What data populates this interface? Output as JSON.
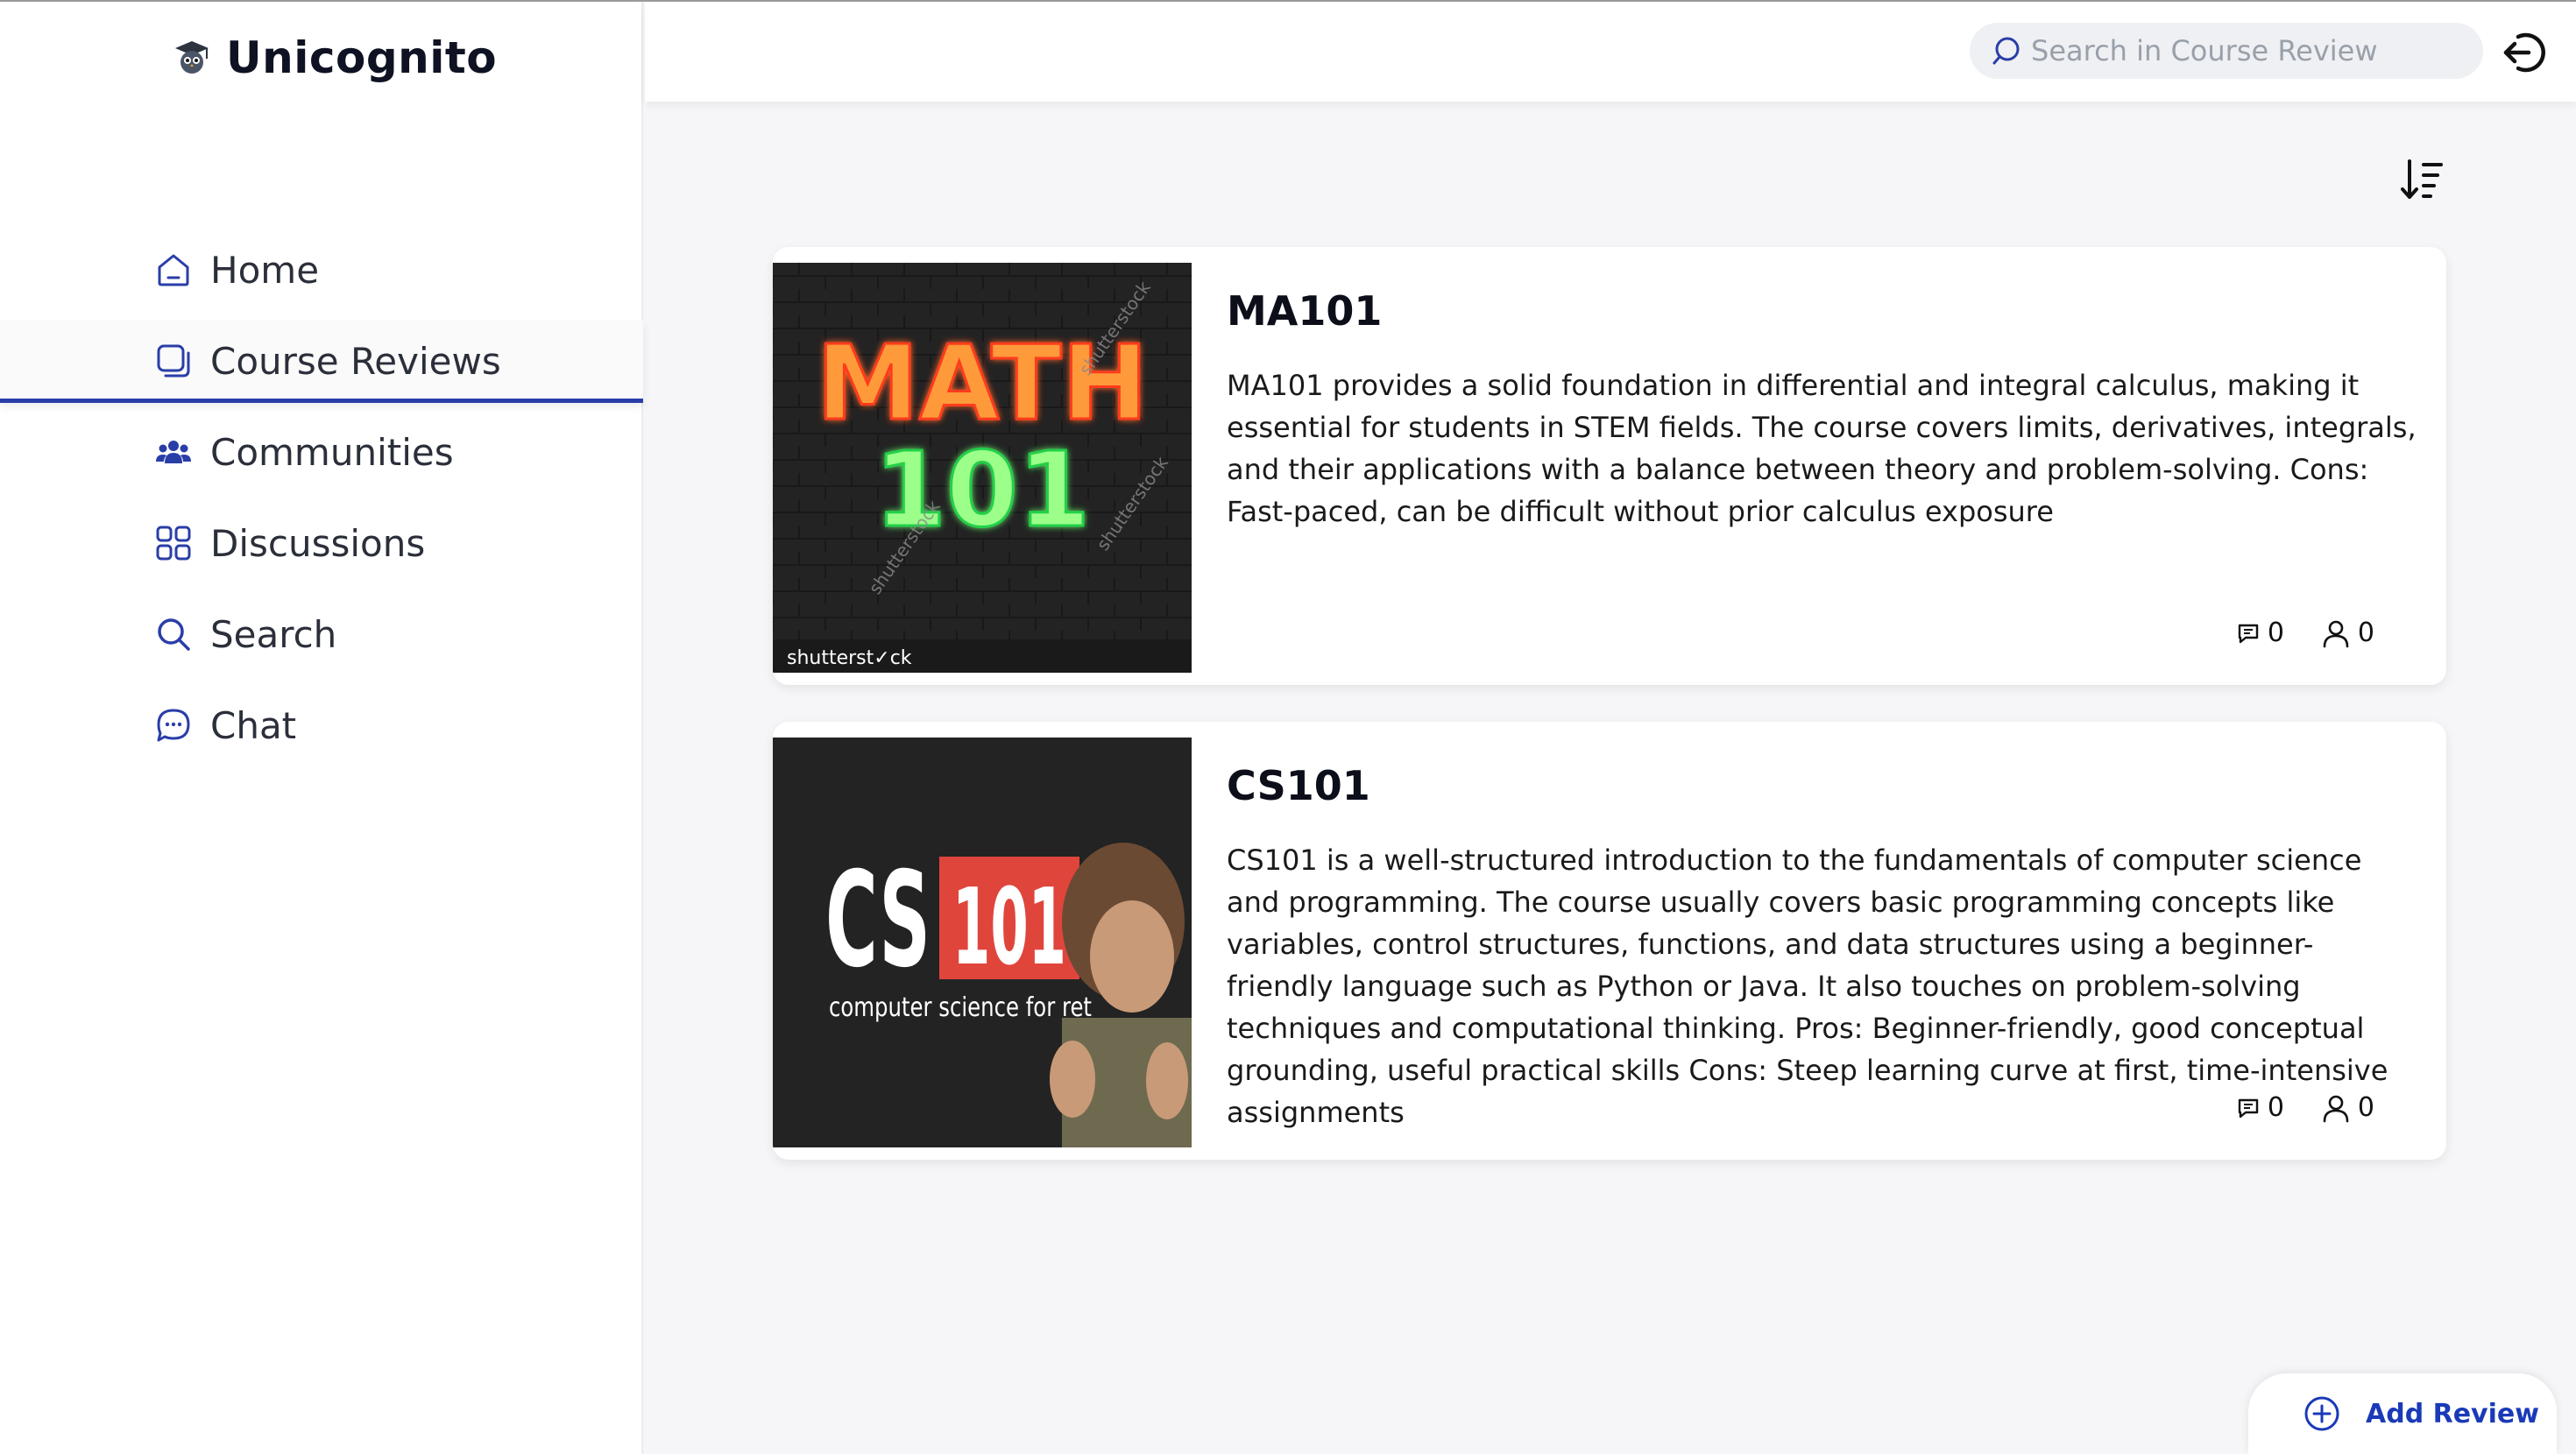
{
  "app": {
    "name": "Unicognito"
  },
  "sidebar": {
    "items": [
      {
        "label": "Home",
        "icon": "home-icon",
        "active": false
      },
      {
        "label": "Course Reviews",
        "icon": "course-reviews-icon",
        "active": true
      },
      {
        "label": "Communities",
        "icon": "communities-icon",
        "active": false
      },
      {
        "label": "Discussions",
        "icon": "discussions-icon",
        "active": false
      },
      {
        "label": "Search",
        "icon": "search-icon",
        "active": false
      },
      {
        "label": "Chat",
        "icon": "chat-icon",
        "active": false
      }
    ]
  },
  "header": {
    "search_placeholder": "Search in Course Review"
  },
  "reviews": [
    {
      "title": "MA101",
      "description": "MA101 provides a solid foundation in differential and integral calculus, making it essential for students in STEM fields. The course covers limits, derivatives, integrals, and their applications with a balance between theory and problem-solving. Cons: Fast-paced, can be difficult without prior calculus exposure",
      "comments": "0",
      "users": "0",
      "thumb": {
        "line1": "MATH",
        "line2": "101",
        "watermark": "shutterstock",
        "footer": "shutterst✓ck"
      }
    },
    {
      "title": "CS101",
      "description": "CS101 is a well-structured introduction to the fundamentals of computer science and programming. The course usually covers basic programming concepts like variables, control structures, functions, and data structures using a beginner-friendly language such as Python or Java. It also touches on problem-solving techniques and computational thinking.   Pros: Beginner-friendly, good conceptual grounding, useful practical skills Cons: Steep learning curve at first, time-intensive assignments",
      "comments": "0",
      "users": "0",
      "thumb": {
        "line1": "CS",
        "line2": "101",
        "caption": "computer science for ret"
      }
    }
  ],
  "actions": {
    "add_review": "Add Review"
  },
  "colors": {
    "accent": "#2a3ea8",
    "link": "#1a3ab8",
    "background": "#f6f6f8"
  }
}
